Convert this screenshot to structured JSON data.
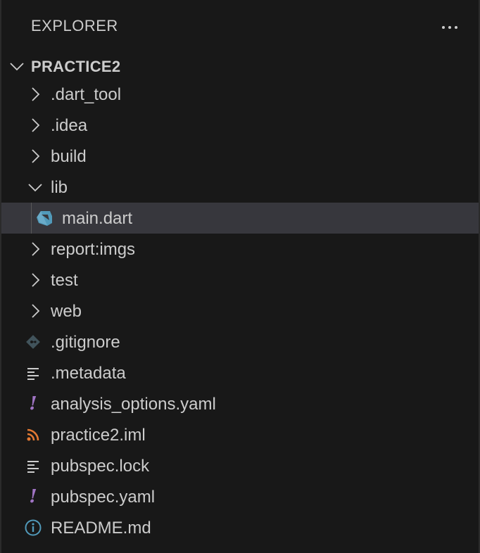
{
  "explorer": {
    "title": "EXPLORER",
    "more_actions_icon": "ellipsis-icon"
  },
  "workspace": {
    "name": "PRACTICE2",
    "expanded": true
  },
  "tree": {
    "items": [
      {
        "label": ".dart_tool",
        "type": "folder",
        "expanded": false
      },
      {
        "label": ".idea",
        "type": "folder",
        "expanded": false
      },
      {
        "label": "build",
        "type": "folder",
        "expanded": false
      },
      {
        "label": "lib",
        "type": "folder",
        "expanded": true
      },
      {
        "label": "main.dart",
        "type": "file",
        "icon": "dart-icon",
        "selected": true
      },
      {
        "label": "report:imgs",
        "type": "folder",
        "expanded": false
      },
      {
        "label": "test",
        "type": "folder",
        "expanded": false
      },
      {
        "label": "web",
        "type": "folder",
        "expanded": false
      },
      {
        "label": ".gitignore",
        "type": "file",
        "icon": "git-icon"
      },
      {
        "label": ".metadata",
        "type": "file",
        "icon": "lines-icon"
      },
      {
        "label": "analysis_options.yaml",
        "type": "file",
        "icon": "exclamation-icon"
      },
      {
        "label": "practice2.iml",
        "type": "file",
        "icon": "rss-icon"
      },
      {
        "label": "pubspec.lock",
        "type": "file",
        "icon": "lines-icon"
      },
      {
        "label": "pubspec.yaml",
        "type": "file",
        "icon": "exclamation-icon"
      },
      {
        "label": "README.md",
        "type": "file",
        "icon": "info-icon"
      }
    ]
  },
  "colors": {
    "background": "#181818",
    "selection": "#37373d",
    "text": "#cccccc",
    "dart": "#519aba",
    "git": "#41535b",
    "yaml": "#a074c4",
    "rss": "#e37933",
    "info": "#519aba"
  }
}
